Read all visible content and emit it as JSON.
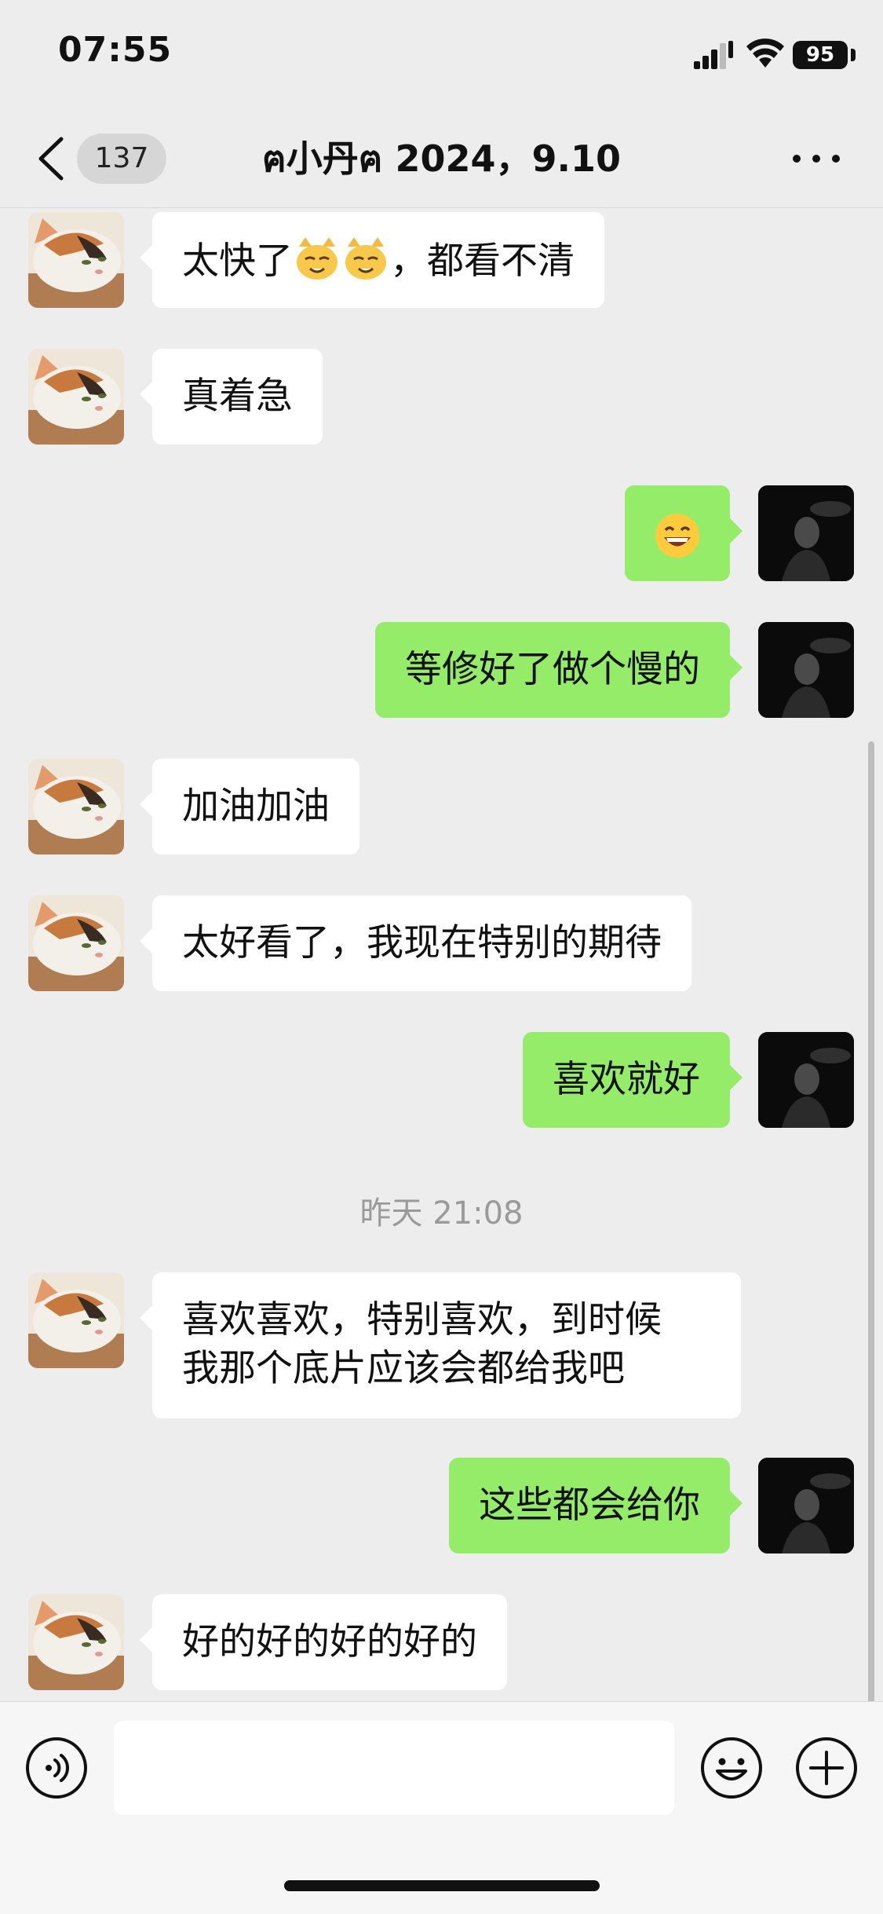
{
  "status_bar": {
    "time": "07:55",
    "battery": "95"
  },
  "nav": {
    "unread_count": "137",
    "title": "ฅ小丹ฅ 2024，9.10"
  },
  "messages": [
    {
      "side": "in",
      "text_before": "太快了",
      "text_after": "，都看不清"
    },
    {
      "side": "in",
      "text": "真着急"
    },
    {
      "side": "out",
      "emoji": "😄"
    },
    {
      "side": "out",
      "text": "等修好了做个慢的"
    },
    {
      "side": "in",
      "text": "加油加油"
    },
    {
      "side": "in",
      "text": "太好看了，我现在特别的期待"
    },
    {
      "side": "out",
      "text": "喜欢就好"
    },
    {
      "side": "in",
      "line1": "喜欢喜欢，特别喜欢，到时候",
      "line2": "我那个底片应该会都给我吧"
    },
    {
      "side": "out",
      "text": "这些都会给你"
    },
    {
      "side": "in",
      "text": "好的好的好的好的"
    }
  ],
  "timestamp": "昨天 21:08",
  "input": {
    "value": "",
    "placeholder": ""
  },
  "icons": {
    "back": "chevron-left-icon",
    "more": "more-dots-icon",
    "voice": "voice-icon",
    "emoji": "emoji-icon",
    "plus": "plus-icon"
  },
  "colors": {
    "background": "#ededed",
    "outgoing_bubble": "#95ec69",
    "incoming_bubble": "#ffffff"
  }
}
